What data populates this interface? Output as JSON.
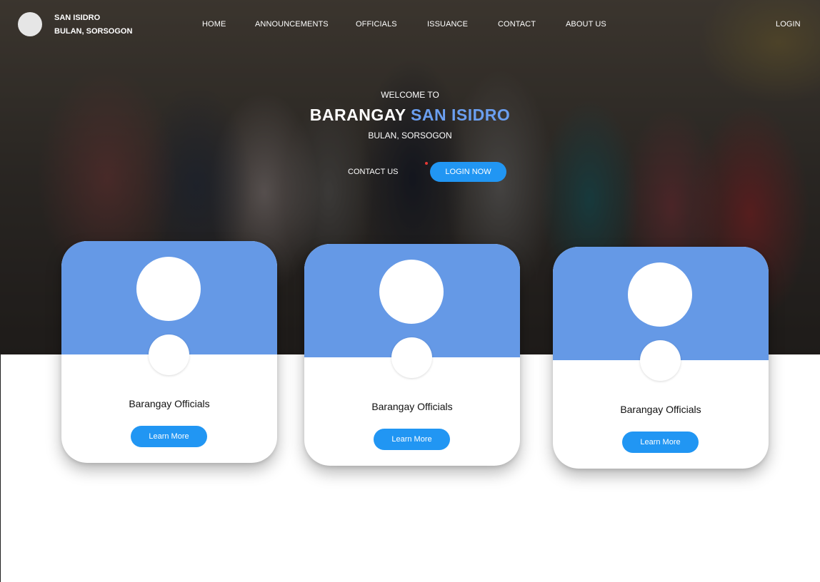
{
  "header": {
    "brand_line1": "SAN ISIDRO",
    "brand_line2": "BULAN, SORSOGON",
    "nav": [
      "HOME",
      "ANNOUNCEMENTS",
      "OFFICIALS",
      "ISSUANCE",
      "CONTACT",
      "ABOUT US"
    ],
    "login_label": "LOGIN"
  },
  "hero": {
    "welcome": "WELCOME TO",
    "title_part1": "BARANGAY ",
    "title_accent": "SAN ISIDRO",
    "subtitle": "BULAN, SORSOGON",
    "contact_label": "CONTACT US",
    "login_now_label": "LOGIN NOW",
    "accent_color": "#6b9ff0"
  },
  "cards": [
    {
      "title": "Barangay Officials",
      "button": "Learn More"
    },
    {
      "title": "Barangay Officials",
      "button": "Learn More"
    },
    {
      "title": "Barangay Officials",
      "button": "Learn More"
    }
  ],
  "colors": {
    "card_top": "#6599e6",
    "button": "#2196f3"
  }
}
